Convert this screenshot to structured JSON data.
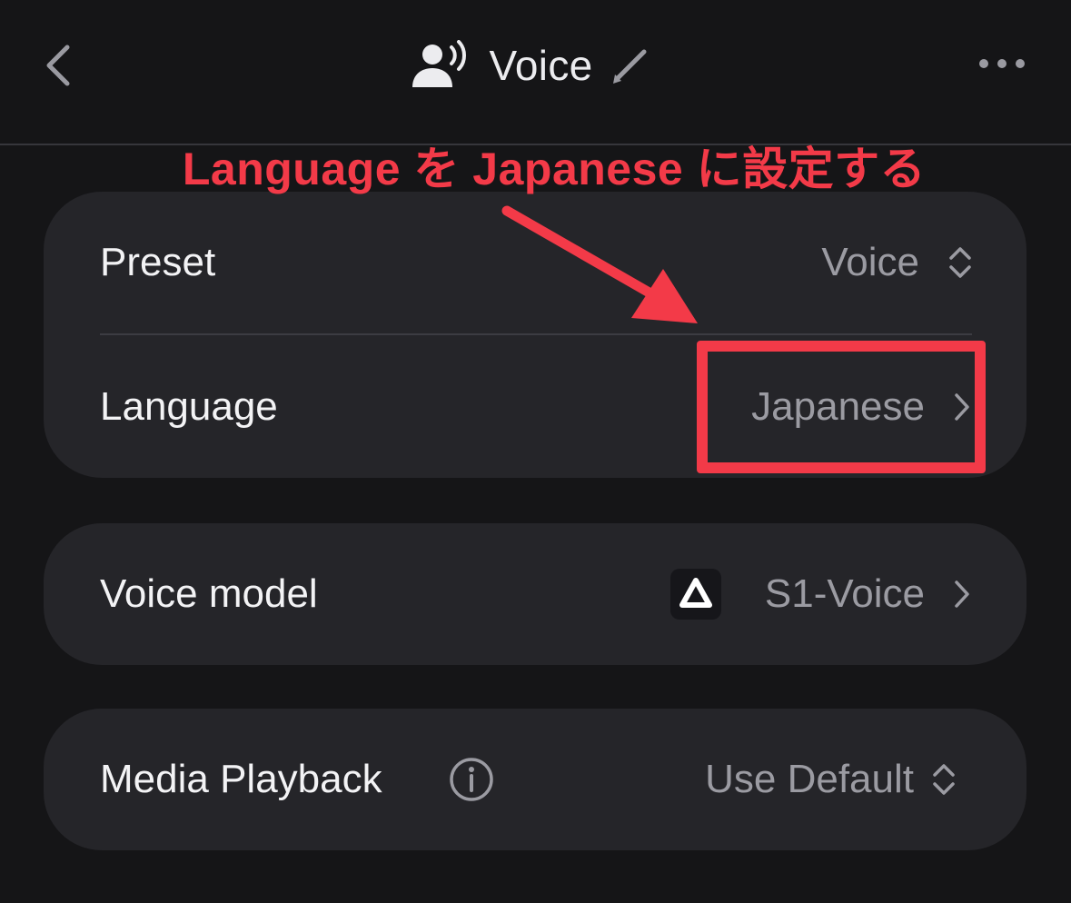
{
  "header": {
    "title": "Voice",
    "back_icon": "chevron-left-icon",
    "title_icon": "speaking-person-icon",
    "edit_icon": "pencil-icon",
    "more_icon": "ellipsis-icon"
  },
  "annotation": {
    "text": "Language を Japanese に設定する",
    "color": "#f33a48"
  },
  "settings": {
    "preset": {
      "label": "Preset",
      "value": "Voice"
    },
    "language": {
      "label": "Language",
      "value": "Japanese"
    },
    "voice_model": {
      "label": "Voice model",
      "value": "S1-Voice",
      "logo_icon": "triangle-logo-icon"
    },
    "media_playback": {
      "label": "Media Playback",
      "value": "Use Default",
      "info_icon": "info-icon"
    }
  },
  "colors": {
    "background": "#151517",
    "card": "#252529",
    "label": "#f3f3f5",
    "value": "#9b9ba2",
    "accent": "#f33a48"
  }
}
